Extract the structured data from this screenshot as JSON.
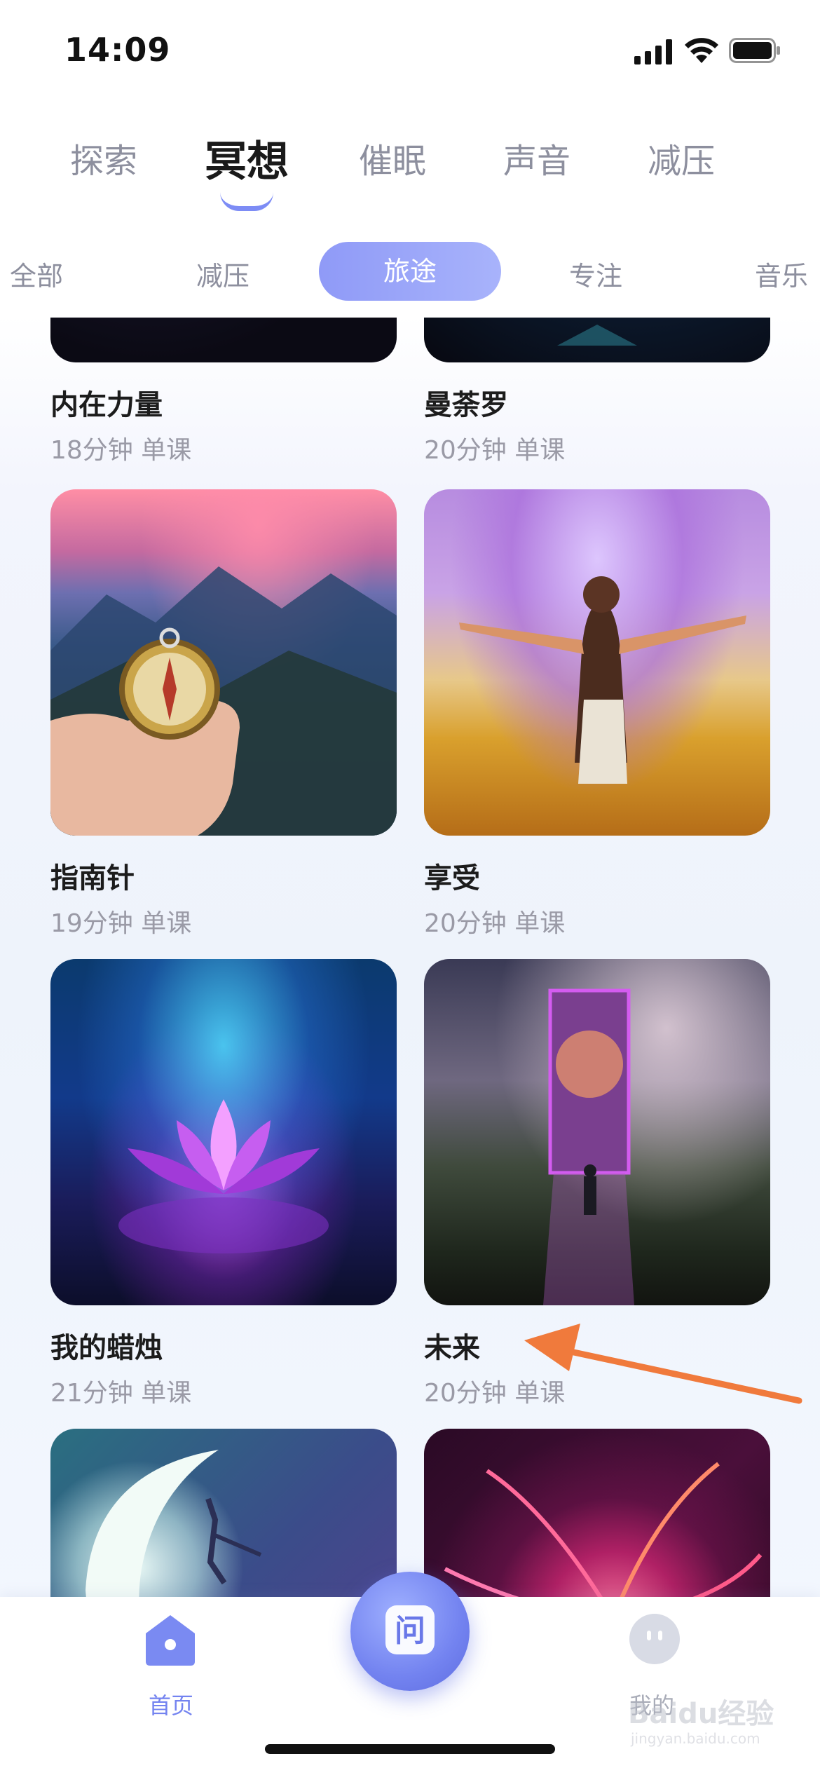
{
  "status_bar": {
    "time": "14:09"
  },
  "main_tabs": [
    {
      "label": "探索"
    },
    {
      "label": "冥想"
    },
    {
      "label": "催眠"
    },
    {
      "label": "声音"
    },
    {
      "label": "减压"
    }
  ],
  "sub_tabs": [
    {
      "label": "全部"
    },
    {
      "label": "减压"
    },
    {
      "label": "旅途"
    },
    {
      "label": "专注"
    },
    {
      "label": "音乐"
    }
  ],
  "cards": [
    {
      "title": "内在力量",
      "meta": "18分钟 单课",
      "image": "dark-space-image"
    },
    {
      "title": "曼荼罗",
      "meta": "20分钟 单课",
      "image": "dark-nebula-image"
    },
    {
      "title": "指南针",
      "meta": "19分钟 单课",
      "image": "compass-mountain-image"
    },
    {
      "title": "享受",
      "meta": "20分钟 单课",
      "image": "woman-field-image"
    },
    {
      "title": "我的蜡烛",
      "meta": "21分钟 单课",
      "image": "lotus-image"
    },
    {
      "title": "未来",
      "meta": "20分钟 单课",
      "image": "portal-image"
    },
    {
      "title": "",
      "meta": "",
      "image": "moon-dancer-image"
    },
    {
      "title": "",
      "meta": "",
      "image": "fractal-flower-image"
    }
  ],
  "bottom_nav": {
    "home_label": "首页",
    "center_icon_char": "问",
    "mine_label": "我的"
  },
  "watermark": {
    "text": "Baidu经验",
    "sub": "jingyan.baidu.com"
  },
  "colors": {
    "accent": "#7383f0",
    "chip_bg": "#9aa4f8",
    "arrow": "#f07a3c"
  }
}
